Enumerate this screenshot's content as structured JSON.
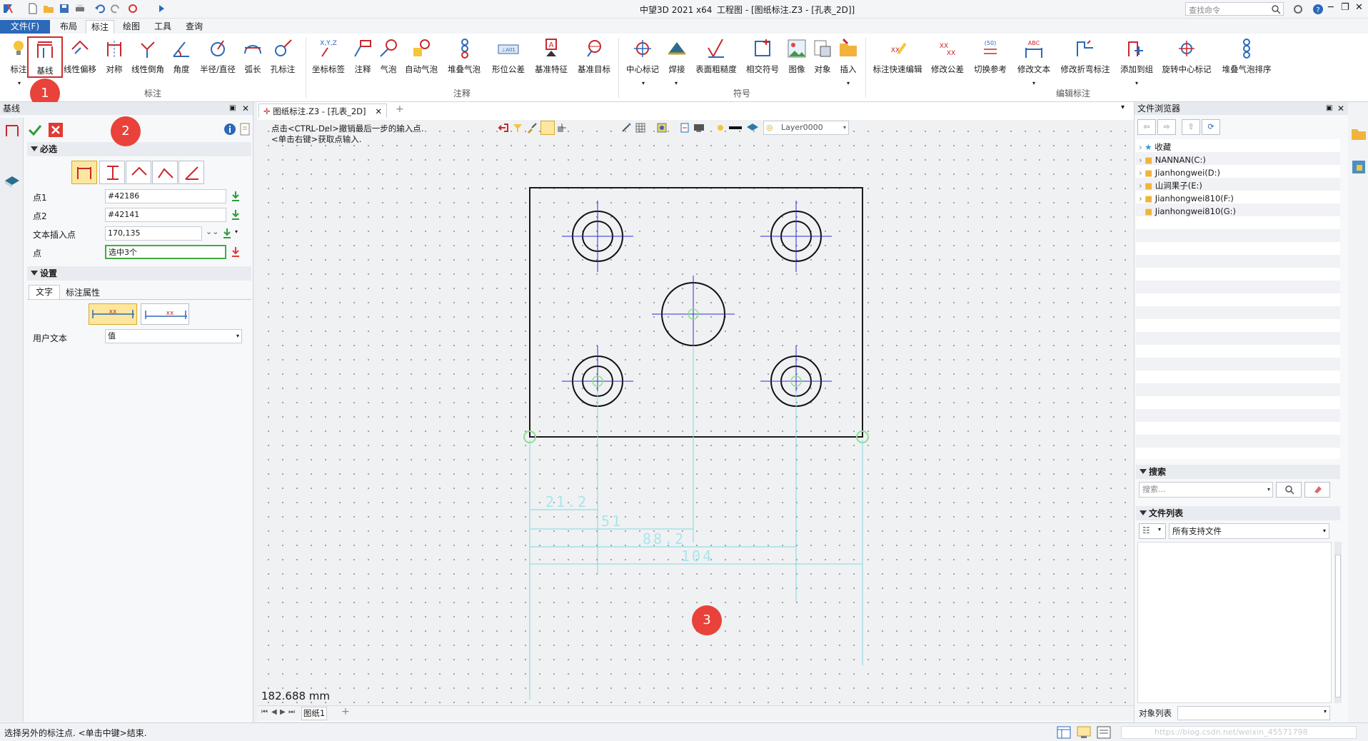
{
  "titlebar": {
    "app": "中望3D 2021 x64",
    "doc": "工程图 - [图纸标注.Z3 - [孔表_2D]]",
    "search_placeholder": "查找命令"
  },
  "menus": [
    "文件(F)",
    "布局",
    "标注",
    "绘图",
    "工具",
    "查询"
  ],
  "ribbon": {
    "group_labels": [
      "标注",
      "注释",
      "符号",
      "编辑标注"
    ],
    "dim_buttons": [
      "标注",
      "基线",
      "线性偏移",
      "对称",
      "线性倒角",
      "角度",
      "半径/直径",
      "弧长",
      "孔标注"
    ],
    "note_buttons": [
      "坐标标签",
      "注释",
      "气泡",
      "自动气泡",
      "堆叠气泡",
      "形位公差",
      "基准特征",
      "基准目标"
    ],
    "symbol_buttons": [
      "中心标记",
      "焊接",
      "表面粗糙度",
      "相交符号",
      "图像",
      "对象",
      "插入"
    ],
    "edit_buttons": [
      "标注快速编辑",
      "修改公差",
      "切换参考",
      "修改文本",
      "修改折弯标注",
      "添加到组",
      "旋转中心标记",
      "堆叠气泡排序"
    ],
    "icon_texts": {
      "xyz": "X,Y,Z",
      "fcf": "⊥A01",
      "datum": "A",
      "tol": "XX",
      "ref": "(50)",
      "abc": "ABC"
    }
  },
  "left_panel": {
    "title": "基线",
    "required_label": "必选",
    "fields": [
      {
        "label": "点1",
        "value": "#42186"
      },
      {
        "label": "点2",
        "value": "#42141"
      },
      {
        "label": "文本插入点",
        "value": "170,135"
      },
      {
        "label": "点",
        "value": "选中3个"
      }
    ],
    "settings_label": "设置",
    "tabs": [
      "文字",
      "标注属性"
    ],
    "user_text_label": "用户文本",
    "user_text_value": "值",
    "dim_sample": "xx"
  },
  "doc_tab": {
    "label": "图纸标注.Z3 - [孔表_2D]",
    "layer": "Layer0000"
  },
  "prompt": [
    "点击<CTRL-Del>撤销最后一步的输入点.",
    "<单击右键>获取点输入."
  ],
  "drawing_dims": [
    "21.2",
    "51",
    "88.2",
    "104"
  ],
  "measure": "182.688 mm",
  "sheet_tab": "图纸1",
  "right_panel": {
    "title": "文件浏览器",
    "tree": [
      "收藏",
      "NANNAN(C:)",
      "Jianhongwei(D:)",
      "山涧果子(E:)",
      "Jianhongwei810(F:)",
      "Jianhongwei810(G:)"
    ],
    "search_section": "搜索",
    "search_placeholder": "搜索...",
    "file_list_section": "文件列表",
    "filter_value": "所有支持文件",
    "object_list_label": "对象列表"
  },
  "status_text": "选择另外的标注点. <单击中键>结束.",
  "watermark": "https://blog.csdn.net/weixin_45571798",
  "badges": [
    "1",
    "2",
    "3"
  ],
  "colors": {
    "accent": "#2b69b9",
    "badge": "#e8423a",
    "dim_cyan": "#7fd6e0",
    "center_line": "#2b2fd6"
  }
}
